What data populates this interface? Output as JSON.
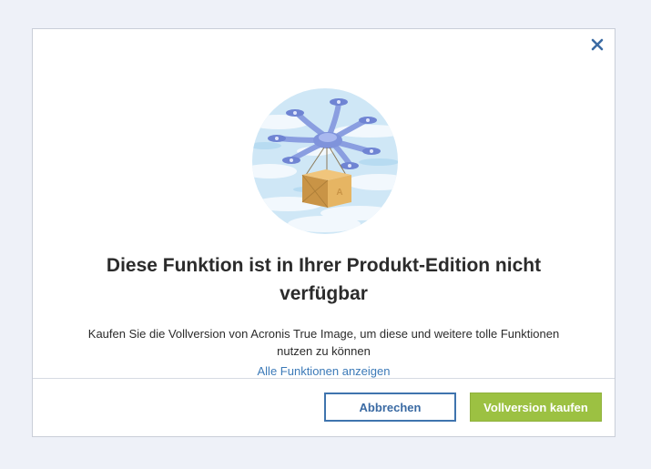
{
  "dialog": {
    "close_icon": "close-icon",
    "illustration_icon": "drone-delivery-illustration",
    "title": "Diese Funktion ist in Ihrer Produkt-Edition nicht verfügbar",
    "description": "Kaufen Sie die Vollversion von Acronis True Image, um diese und weitere tolle Funktionen nutzen zu können",
    "link_label": "Alle Funktionen anzeigen",
    "cancel_label": "Abbrechen",
    "buy_label": "Vollversion kaufen"
  },
  "colors": {
    "background": "#eef1f8",
    "accent_blue": "#3f74ae",
    "link_blue": "#3c7ab8",
    "buy_green": "#9cc142",
    "text": "#2b2b2b"
  }
}
